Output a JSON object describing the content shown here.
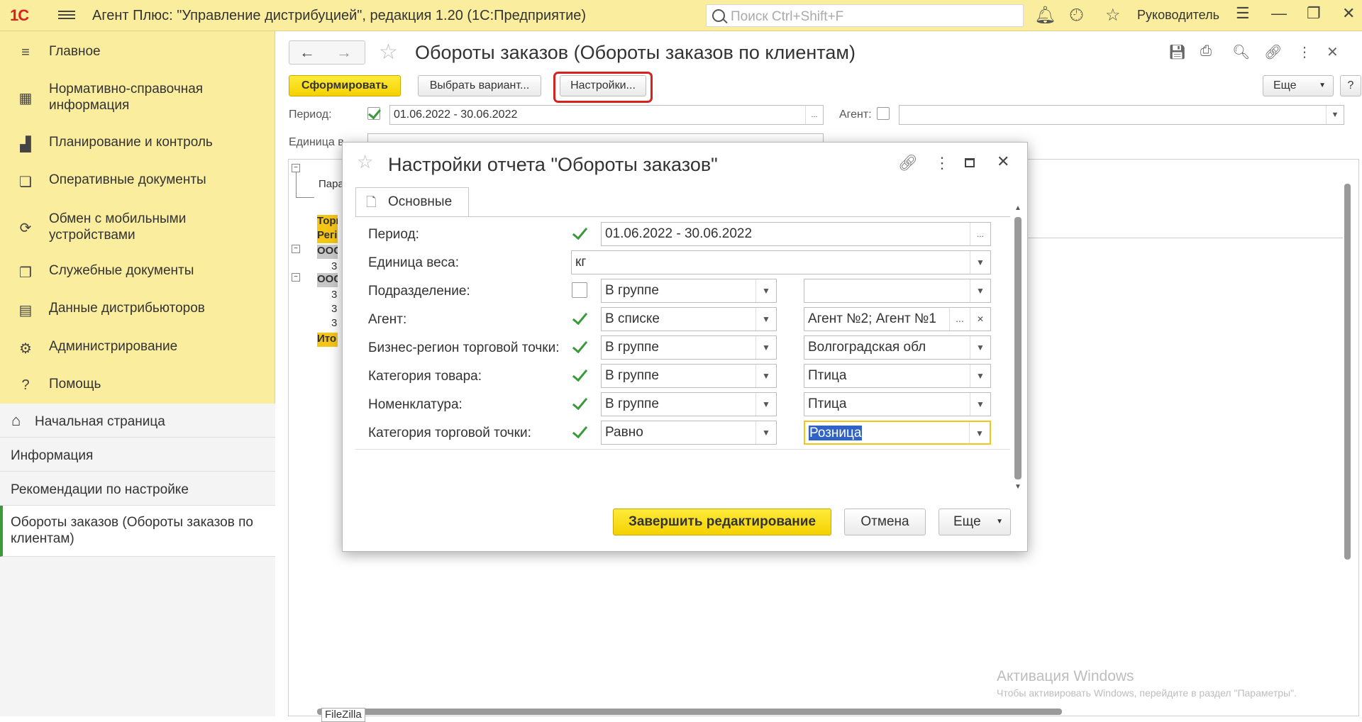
{
  "topbar": {
    "logo": "1С",
    "app_title": "Агент Плюс: \"Управление дистрибуцией\", редакция 1.20  (1С:Предприятие)",
    "search_placeholder": "Поиск Ctrl+Shift+F",
    "user": "Руководитель"
  },
  "sidebar": {
    "sections": [
      {
        "label": "Главное",
        "icon": "menu-lines-icon"
      },
      {
        "label": "Нормативно-справочная информация",
        "icon": "grid-icon"
      },
      {
        "label": "Планирование и контроль",
        "icon": "bar-chart-icon"
      },
      {
        "label": "Оперативные документы",
        "icon": "documents-icon"
      },
      {
        "label": "Обмен с мобильными устройствами",
        "icon": "sync-icon"
      },
      {
        "label": "Служебные документы",
        "icon": "service-docs-icon"
      },
      {
        "label": "Данные дистрибьюторов",
        "icon": "data-icon"
      },
      {
        "label": "Администрирование",
        "icon": "gear-icon"
      },
      {
        "label": "Помощь",
        "icon": "question-icon"
      }
    ],
    "open_windows": [
      {
        "label": "Начальная страница"
      },
      {
        "label": "Информация"
      },
      {
        "label": "Рекомендации по настройке"
      },
      {
        "label": "Обороты заказов (Обороты заказов по клиентам)"
      }
    ]
  },
  "form": {
    "title": "Обороты заказов (Обороты заказов по клиентам)",
    "generate_label": "Сформировать",
    "choose_variant_label": "Выбрать вариант...",
    "settings_label": "Настройки...",
    "more_label": "Еще",
    "help_label": "?",
    "period_label": "Период:",
    "period_value": "01.06.2022 - 30.06.2022",
    "agent_label": "Агент:",
    "weight_label": "Единица в",
    "report": {
      "params_text": "Пара",
      "hdr1": "Торг",
      "hdr2": "Регі",
      "group1": "ООС",
      "group2": "ООС",
      "row": "3",
      "total": "Ито"
    },
    "watermark_title": "Активация Windows",
    "watermark_text": "Чтобы активировать Windows, перейдите в раздел \"Параметры\".",
    "taskbar_tip": "FileZilla"
  },
  "modal": {
    "title": "Настройки отчета \"Обороты заказов\"",
    "tab": "Основные",
    "rows": [
      {
        "label": "Период:",
        "checked": true,
        "value": "01.06.2022 - 30.06.2022"
      },
      {
        "label": "Единица веса:",
        "value": "кг"
      },
      {
        "label": "Подразделение:",
        "checked": false,
        "condition": "В группе",
        "value": ""
      },
      {
        "label": "Агент:",
        "checked": true,
        "condition": "В списке",
        "value": "Агент №2; Агент №1"
      },
      {
        "label": "Бизнес-регион торговой точки:",
        "checked": true,
        "condition": "В группе",
        "value": "Волгоградская обл"
      },
      {
        "label": "Категория товара:",
        "checked": true,
        "condition": "В группе",
        "value": "Птица"
      },
      {
        "label": "Номенклатура:",
        "checked": true,
        "condition": "В группе",
        "value": "Птица"
      },
      {
        "label": "Категория торговой точки:",
        "checked": true,
        "condition": "Равно",
        "value": "Розница"
      }
    ],
    "finish_label": "Завершить редактирование",
    "cancel_label": "Отмена",
    "more_label": "Еще"
  },
  "colors": {
    "accent_yellow": "#fbed9e",
    "button_yellow": "#f5d100",
    "check_green": "#3a9a3a",
    "highlight_red": "#d6231f"
  }
}
